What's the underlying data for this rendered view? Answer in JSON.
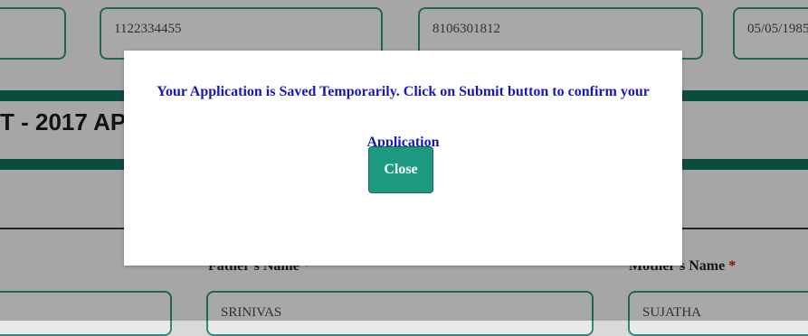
{
  "form": {
    "top_fields": [
      "",
      "1122334455",
      "8106301812",
      "05/05/1985"
    ],
    "title": "T - 2017 AP",
    "fathers_name_label": "Father's Name",
    "mothers_name_label": "Mother's Name",
    "required_mark": "*",
    "fathers_name_value": "SRINIVAS",
    "mothers_name_value": "SUJATHA"
  },
  "modal": {
    "message_line1": "Your Application is Saved Temporarily. Click on Submit button to confirm your",
    "message_line2": "Application",
    "close_label": "Close"
  },
  "colors": {
    "accent": "#1b9a7f",
    "band": "#0f6b58",
    "message": "#1717b8"
  }
}
